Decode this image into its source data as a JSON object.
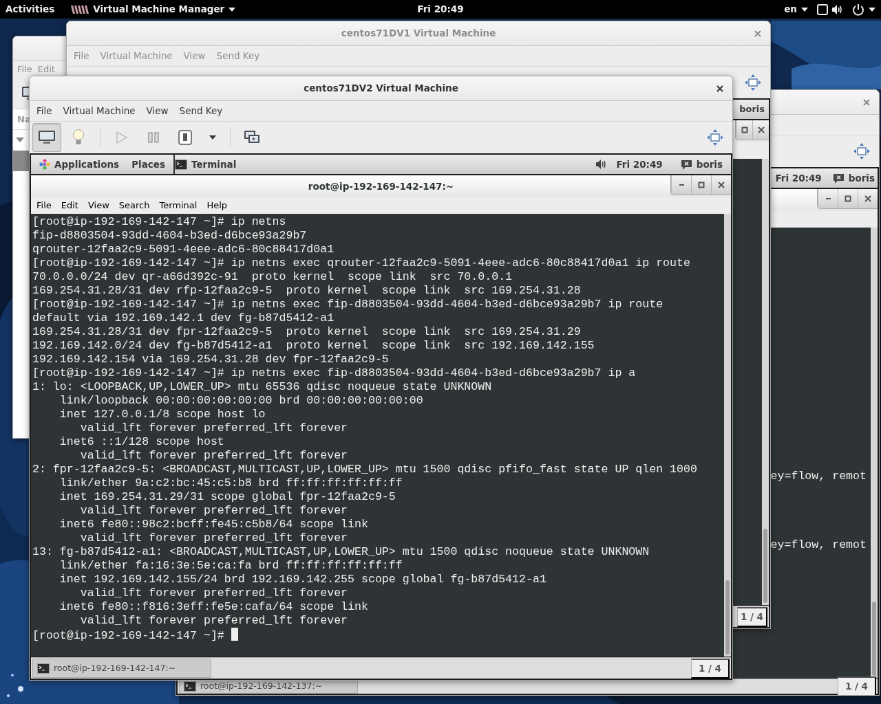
{
  "top_bar": {
    "activities": "Activities",
    "app_menu": "Virtual Machine Manager",
    "clock": "Fri 20:49",
    "language": "en"
  },
  "manager_window": {
    "menu": [
      "File",
      "Edit"
    ],
    "column_header": "Na"
  },
  "vm_window_back": {
    "active": false,
    "guest": {
      "panel": {
        "clock": "Fri 20:49",
        "user": "boris"
      },
      "terminal": {
        "lines": [
          "ey=flow, remot",
          "ey=flow, remot"
        ]
      },
      "taskbar": {
        "item": "root@ip-192-169-142-137:~",
        "workspace": "1 / 4"
      }
    }
  },
  "vm_window_1": {
    "title": "centos71DV1 Virtual Machine",
    "active": false,
    "menu": [
      "File",
      "Virtual Machine",
      "View",
      "Send Key"
    ],
    "guest": {
      "panel": {
        "user": "boris"
      },
      "taskbar": {
        "workspace": "1 / 4"
      }
    }
  },
  "vm_window_2": {
    "title": "centos71DV2 Virtual Machine",
    "active": true,
    "menu": [
      "File",
      "Virtual Machine",
      "View",
      "Send Key"
    ],
    "view_toggles": [
      {
        "kind": "console",
        "selected": true
      },
      {
        "kind": "details",
        "selected": false
      }
    ],
    "controls": [
      {
        "kind": "run",
        "disabled": true
      },
      {
        "kind": "pause",
        "disabled": false
      },
      {
        "kind": "shutdown",
        "disabled": false
      },
      {
        "kind": "shutdown_menu",
        "disabled": false
      },
      {
        "kind": "snapshots",
        "disabled": false
      }
    ],
    "guest": {
      "panel": {
        "applications": "Applications",
        "places": "Places",
        "task": "Terminal",
        "clock": "Fri 20:49",
        "user": "boris"
      },
      "terminal": {
        "title": "root@ip-192-169-142-147:~",
        "menu": [
          "File",
          "Edit",
          "View",
          "Search",
          "Terminal",
          "Help"
        ],
        "lines": [
          "[root@ip-192-169-142-147 ~]# ip netns",
          "fip-d8803504-93dd-4604-b3ed-d6bce93a29b7",
          "qrouter-12faa2c9-5091-4eee-adc6-80c88417d0a1",
          "[root@ip-192-169-142-147 ~]# ip netns exec qrouter-12faa2c9-5091-4eee-adc6-80c88417d0a1 ip route",
          "70.0.0.0/24 dev qr-a66d392c-91  proto kernel  scope link  src 70.0.0.1",
          "169.254.31.28/31 dev rfp-12faa2c9-5  proto kernel  scope link  src 169.254.31.28",
          "[root@ip-192-169-142-147 ~]# ip netns exec fip-d8803504-93dd-4604-b3ed-d6bce93a29b7 ip route",
          "default via 192.169.142.1 dev fg-b87d5412-a1",
          "169.254.31.28/31 dev fpr-12faa2c9-5  proto kernel  scope link  src 169.254.31.29",
          "192.169.142.0/24 dev fg-b87d5412-a1  proto kernel  scope link  src 192.169.142.155",
          "192.169.142.154 via 169.254.31.28 dev fpr-12faa2c9-5",
          "[root@ip-192-169-142-147 ~]# ip netns exec fip-d8803504-93dd-4604-b3ed-d6bce93a29b7 ip a",
          "1: lo: <LOOPBACK,UP,LOWER_UP> mtu 65536 qdisc noqueue state UNKNOWN",
          "    link/loopback 00:00:00:00:00:00 brd 00:00:00:00:00:00",
          "    inet 127.0.0.1/8 scope host lo",
          "       valid_lft forever preferred_lft forever",
          "    inet6 ::1/128 scope host",
          "       valid_lft forever preferred_lft forever",
          "2: fpr-12faa2c9-5: <BROADCAST,MULTICAST,UP,LOWER_UP> mtu 1500 qdisc pfifo_fast state UP qlen 1000",
          "    link/ether 9a:c2:bc:45:c5:b8 brd ff:ff:ff:ff:ff:ff",
          "    inet 169.254.31.29/31 scope global fpr-12faa2c9-5",
          "       valid_lft forever preferred_lft forever",
          "    inet6 fe80::98c2:bcff:fe45:c5b8/64 scope link",
          "       valid_lft forever preferred_lft forever",
          "13: fg-b87d5412-a1: <BROADCAST,MULTICAST,UP,LOWER_UP> mtu 1500 qdisc noqueue state UNKNOWN",
          "    link/ether fa:16:3e:5e:ca:fa brd ff:ff:ff:ff:ff:ff",
          "    inet 192.169.142.155/24 brd 192.169.142.255 scope global fg-b87d5412-a1",
          "       valid_lft forever preferred_lft forever",
          "    inet6 fe80::f816:3eff:fe5e:cafa/64 scope link",
          "       valid_lft forever preferred_lft forever",
          "[root@ip-192-169-142-147 ~]#"
        ]
      },
      "taskbar": {
        "item": "root@ip-192-169-142-147:~",
        "workspace": "1 / 4"
      }
    }
  }
}
